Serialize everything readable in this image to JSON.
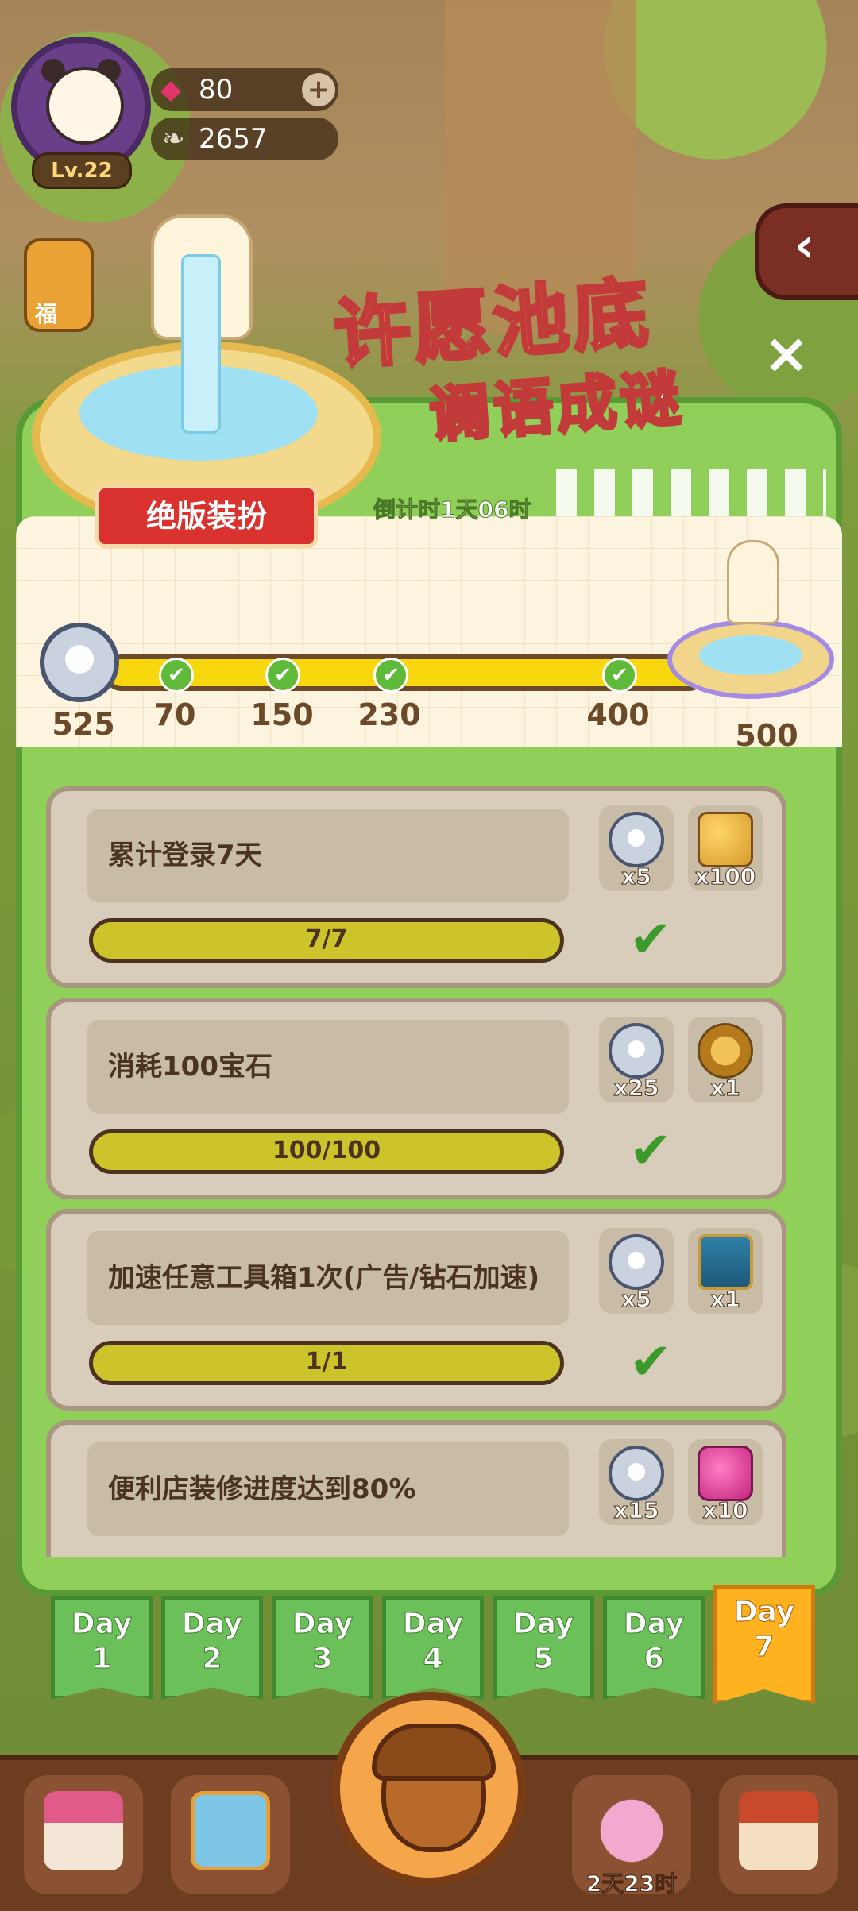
{
  "hud": {
    "level": "Lv.22",
    "gems": "80",
    "gems_plus": "+",
    "seeds": "2657",
    "back_glyph": "‹",
    "side_label": "福"
  },
  "event": {
    "title_line1": "许愿池底",
    "title_line2": "谰语成谜",
    "close_glyph": "×",
    "ribbon_label": "绝版装扮",
    "countdown": "倒计时1天06时"
  },
  "progress": {
    "current_total": "525",
    "milestones": [
      {
        "value": "70",
        "done": true
      },
      {
        "value": "150",
        "done": true
      },
      {
        "value": "230",
        "done": true
      },
      {
        "value": "400",
        "done": true
      },
      {
        "value": "500",
        "done": false
      }
    ]
  },
  "tasks": [
    {
      "label": "累计登录7天",
      "progress_text": "7/7",
      "rewards": [
        {
          "icon": "paw-coin-icon",
          "qty": "x5"
        },
        {
          "icon": "gold-coins-icon",
          "qty": "x100"
        }
      ],
      "done": true
    },
    {
      "label": "消耗100宝石",
      "progress_text": "100/100",
      "rewards": [
        {
          "icon": "paw-coin-icon",
          "qty": "x25"
        },
        {
          "icon": "key-icon",
          "qty": "x1"
        }
      ],
      "done": true
    },
    {
      "label": "加速任意工具箱1次(广告/钻石加速)",
      "progress_text": "1/1",
      "rewards": [
        {
          "icon": "paw-coin-icon",
          "qty": "x5"
        },
        {
          "icon": "toolbox-chest-icon",
          "qty": "x1"
        }
      ],
      "done": true
    },
    {
      "label": "便利店装修进度达到80%",
      "progress_text": "",
      "rewards": [
        {
          "icon": "paw-coin-icon",
          "qty": "x15"
        },
        {
          "icon": "pink-gems-icon",
          "qty": "x10"
        }
      ],
      "done": false
    }
  ],
  "check_glyph": "✔",
  "days": [
    {
      "label": "Day",
      "num": "1"
    },
    {
      "label": "Day",
      "num": "2"
    },
    {
      "label": "Day",
      "num": "3"
    },
    {
      "label": "Day",
      "num": "4"
    },
    {
      "label": "Day",
      "num": "5"
    },
    {
      "label": "Day",
      "num": "6"
    },
    {
      "label": "Day",
      "num": "7"
    }
  ],
  "active_day": 7,
  "bottom_nav": {
    "timer": "2天23时"
  },
  "colors": {
    "panel_green": "#8fcf5a",
    "progress_yellow": "#f7d70e",
    "ribbon_red": "#d9322f",
    "day_active": "#ffb21f"
  }
}
